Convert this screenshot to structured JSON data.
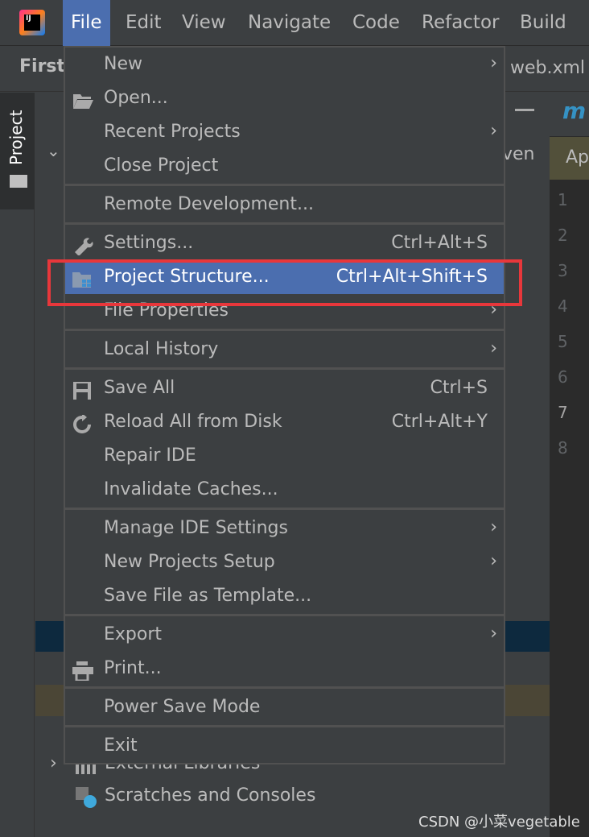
{
  "menubar": {
    "items": [
      "File",
      "Edit",
      "View",
      "Navigate",
      "Code",
      "Refactor",
      "Build"
    ]
  },
  "toolbar": {
    "project": "First",
    "tab": "web.xml",
    "maven_fragment": "ven",
    "editor_tab_fragment": "Ap",
    "module_fragment": "m"
  },
  "sidebar": {
    "project_tab": "Project"
  },
  "editor": {
    "line_numbers": [
      "1",
      "2",
      "3",
      "4",
      "5",
      "6",
      "7",
      "8"
    ]
  },
  "tree": {
    "external_libraries": "External Libraries",
    "scratches": "Scratches and Consoles"
  },
  "file_menu": {
    "items": [
      {
        "label": "New",
        "submenu": true
      },
      {
        "label": "Open...",
        "icon": "folder-open-icon"
      },
      {
        "label": "Recent Projects",
        "submenu": true
      },
      {
        "label": "Close Project"
      },
      {
        "label": "Remote Development..."
      },
      {
        "label": "Settings...",
        "shortcut": "Ctrl+Alt+S",
        "icon": "wrench-icon"
      },
      {
        "label": "Project Structure...",
        "shortcut": "Ctrl+Alt+Shift+S",
        "icon": "project-structure-icon",
        "selected": true
      },
      {
        "label": "File Properties",
        "submenu": true
      },
      {
        "label": "Local History",
        "submenu": true
      },
      {
        "label": "Save All",
        "shortcut": "Ctrl+S",
        "icon": "save-icon"
      },
      {
        "label": "Reload All from Disk",
        "shortcut": "Ctrl+Alt+Y",
        "icon": "reload-icon"
      },
      {
        "label": "Repair IDE"
      },
      {
        "label": "Invalidate Caches..."
      },
      {
        "label": "Manage IDE Settings",
        "submenu": true
      },
      {
        "label": "New Projects Setup",
        "submenu": true
      },
      {
        "label": "Save File as Template..."
      },
      {
        "label": "Export",
        "submenu": true
      },
      {
        "label": "Print...",
        "icon": "print-icon"
      },
      {
        "label": "Power Save Mode"
      },
      {
        "label": "Exit"
      }
    ]
  },
  "watermark": "CSDN @小菜vegetable",
  "colors": {
    "selection": "#4b6eaf",
    "highlight_box": "#e8373b"
  }
}
